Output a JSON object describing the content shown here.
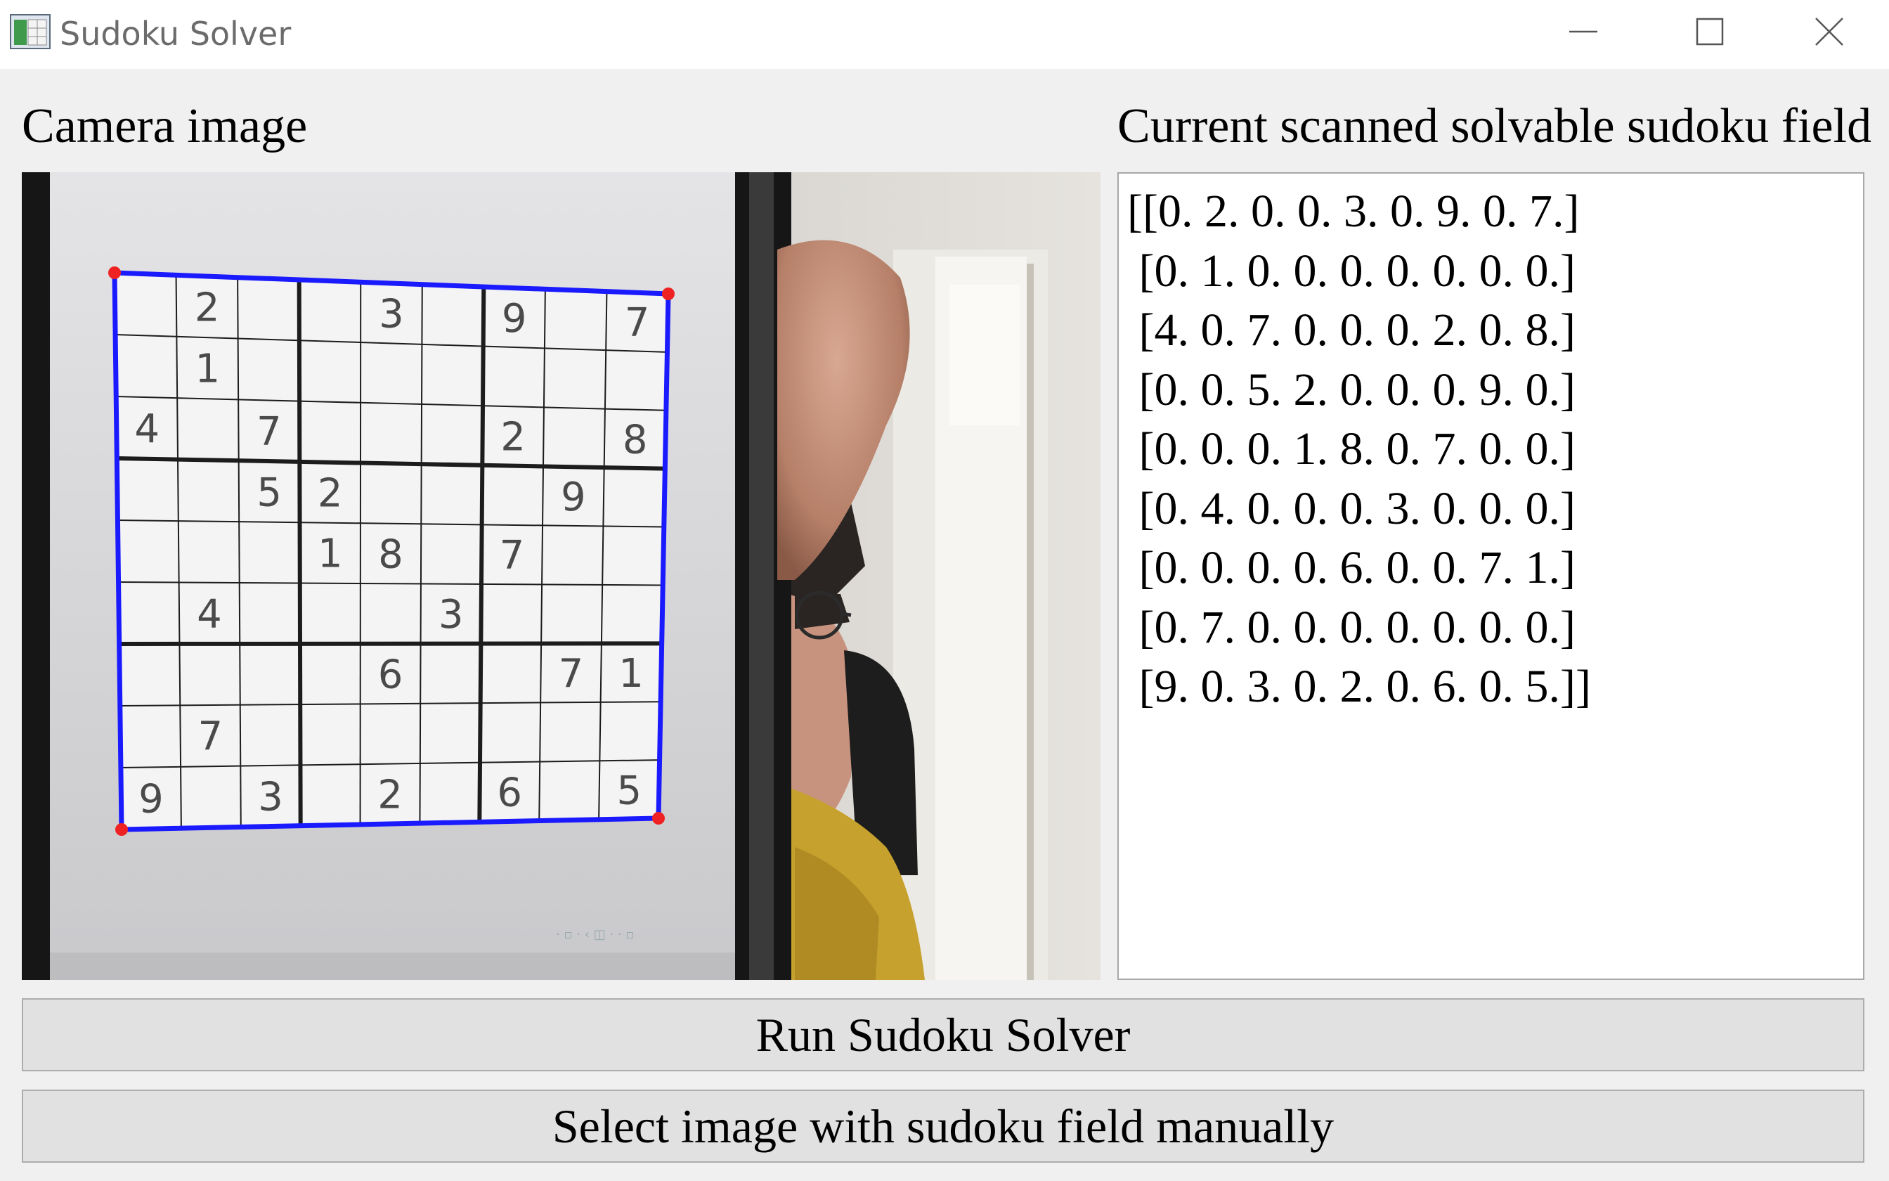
{
  "window": {
    "title": "Sudoku Solver",
    "icon": "sudoku-app-icon",
    "controls": [
      "minimize-icon",
      "maximize-icon",
      "close-icon"
    ]
  },
  "labels": {
    "camera": "Camera image",
    "field": "Current scanned solvable sudoku field"
  },
  "camera": {
    "description_icon": "camera-feed",
    "sudoku_grid": [
      [
        0,
        2,
        0,
        0,
        3,
        0,
        9,
        0,
        7
      ],
      [
        0,
        1,
        0,
        0,
        0,
        0,
        0,
        0,
        0
      ],
      [
        4,
        0,
        7,
        0,
        0,
        0,
        2,
        0,
        8
      ],
      [
        0,
        0,
        5,
        2,
        0,
        0,
        0,
        9,
        0
      ],
      [
        0,
        0,
        0,
        1,
        8,
        0,
        7,
        0,
        0
      ],
      [
        0,
        4,
        0,
        0,
        0,
        3,
        0,
        0,
        0
      ],
      [
        0,
        0,
        0,
        0,
        6,
        0,
        0,
        7,
        1
      ],
      [
        0,
        7,
        0,
        0,
        0,
        0,
        0,
        0,
        0
      ],
      [
        9,
        0,
        3,
        0,
        2,
        0,
        6,
        0,
        5
      ]
    ],
    "detection_color": "#1a1aff",
    "corner_color": "#ee2222"
  },
  "field_text": {
    "lines": [
      "[[0. 2. 0. 0. 3. 0. 9. 0. 7.]",
      " [0. 1. 0. 0. 0. 0. 0. 0. 0.]",
      " [4. 0. 7. 0. 0. 0. 2. 0. 8.]",
      " [0. 0. 5. 2. 0. 0. 0. 9. 0.]",
      " [0. 0. 0. 1. 8. 0. 7. 0. 0.]",
      " [0. 4. 0. 0. 0. 3. 0. 0. 0.]",
      " [0. 0. 0. 0. 6. 0. 0. 7. 1.]",
      " [0. 7. 0. 0. 0. 0. 0. 0. 0.]",
      " [9. 0. 3. 0. 2. 0. 6. 0. 5.]]"
    ]
  },
  "buttons": {
    "run": "Run Sudoku Solver",
    "select": "Select image with sudoku field manually"
  }
}
